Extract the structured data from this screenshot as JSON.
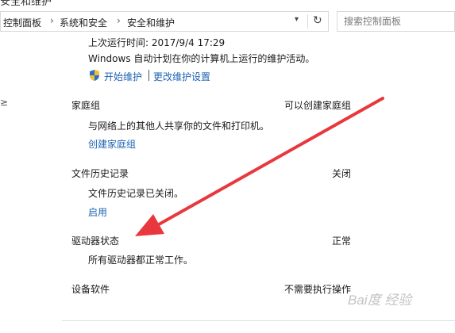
{
  "window": {
    "title_partial": "安全和维护"
  },
  "address_bar": {
    "crumbs": [
      "控制面板",
      "系统和安全",
      "安全和维护"
    ],
    "dropdown_icon": "chevron-down-icon",
    "refresh_icon": "refresh-icon"
  },
  "search": {
    "placeholder": "搜索控制面板"
  },
  "maintenance": {
    "last_run": "上次运行时间: 2017/9/4 17:29",
    "description": "Windows 自动计划在你的计算机上运行的维护活动。",
    "start_link": "开始维护",
    "settings_link": "更改维护设置",
    "shield_icon": "uac-shield-icon"
  },
  "sections": {
    "homegroup": {
      "title": "家庭组",
      "status": "可以创建家庭组",
      "detail": "与网络上的其他人共享你的文件和打印机。",
      "link": "创建家庭组"
    },
    "file_history": {
      "title": "文件历史记录",
      "status": "关闭",
      "detail": "文件历史记录已关闭。",
      "link": "启用"
    },
    "drive_status": {
      "title": "驱动器状态",
      "status": "正常",
      "detail": "所有驱动器都正常工作。"
    },
    "device_software": {
      "title": "设备软件",
      "status": "不需要执行操作"
    }
  },
  "left_edge_glyph": "≥",
  "watermark": "Bai度 经验",
  "colors": {
    "link": "#1e63b3",
    "arrow": "#e8383d"
  }
}
